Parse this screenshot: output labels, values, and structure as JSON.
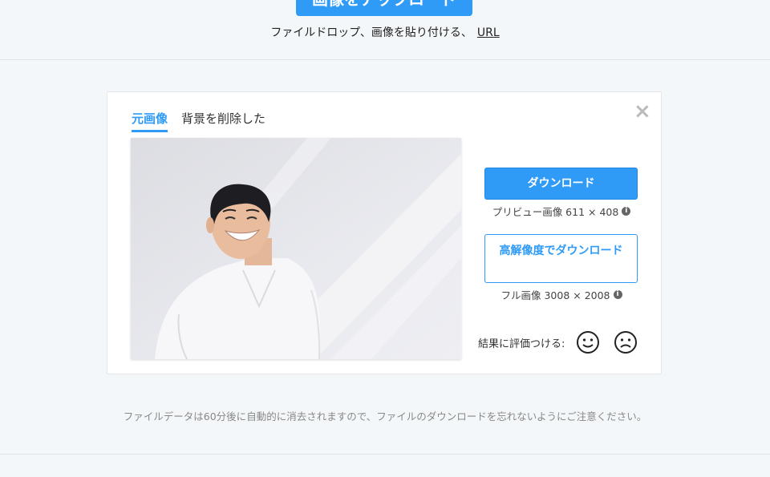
{
  "upload": {
    "button_label": "画像をアップロード",
    "hint_text": "ファイルドロップ、画像を貼り付ける、",
    "url_label": "URL"
  },
  "result_card": {
    "tabs": [
      {
        "label": "元画像",
        "active": true
      },
      {
        "label": "背景を削除した",
        "active": false
      }
    ],
    "close_icon": "close-icon",
    "download_label": "ダウンロード",
    "preview_info": "プリビュー画像 611 × 408",
    "hd_download_label": "高解像度でダウンロード",
    "full_info": "フル画像 3008 × 2008",
    "rating_label": "結果に評価つける:"
  },
  "footer_note": "ファイルデータは60分後に自動的に消去されますので、ファイルのダウンロードを忘れないようにご注意ください。",
  "colors": {
    "accent": "#2f9bf7",
    "background": "#f4f7f9"
  }
}
